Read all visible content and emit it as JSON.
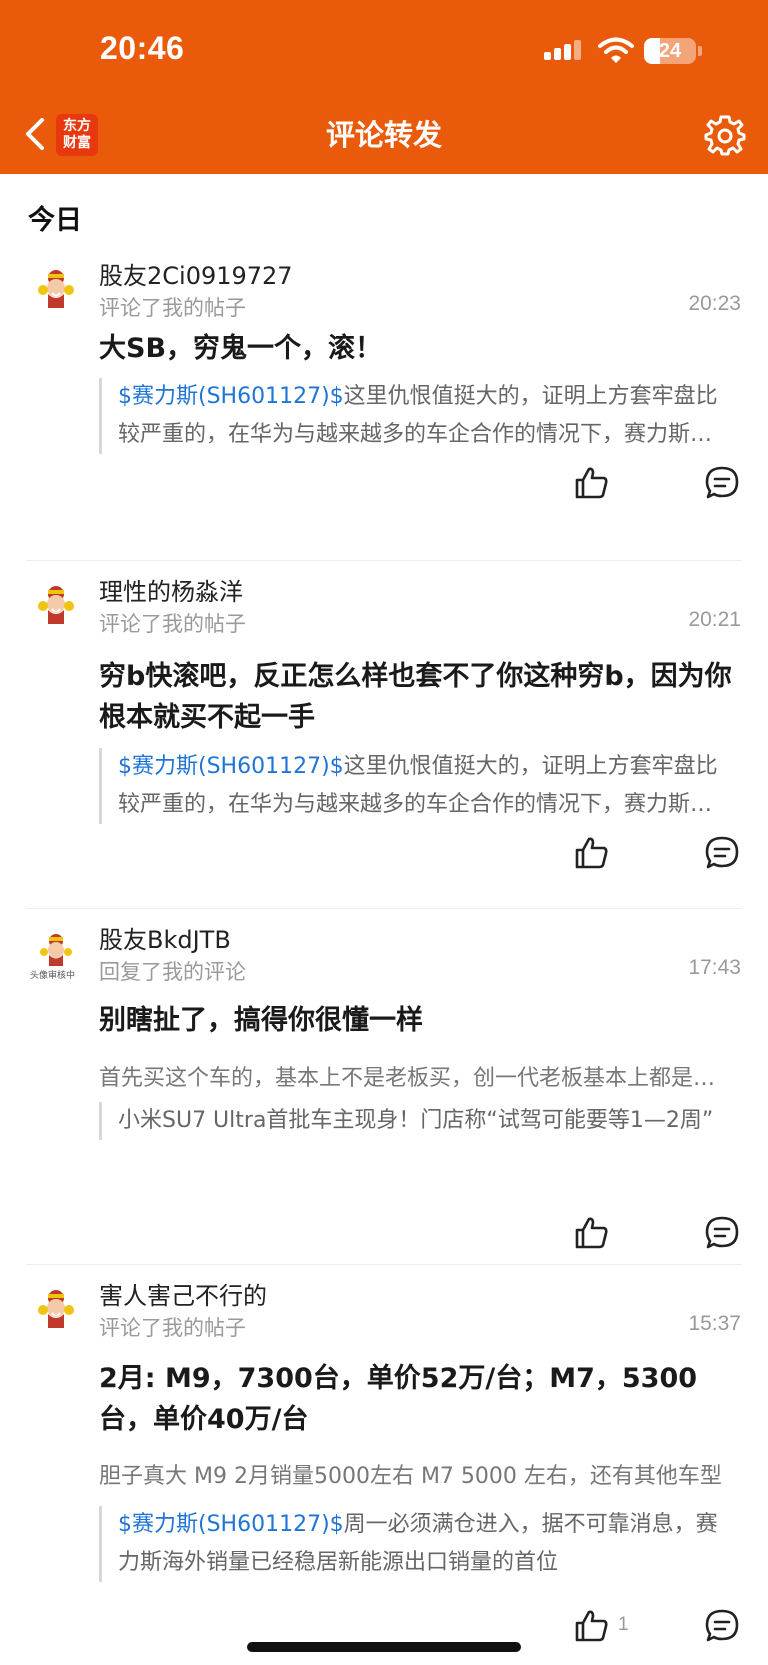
{
  "status_bar": {
    "time": "20:46",
    "battery": "24"
  },
  "header": {
    "logo_line1": "东方",
    "logo_line2": "财富",
    "title": "评论转发"
  },
  "section_title": "今日",
  "items": [
    {
      "username": "股友2Ci0919727",
      "action": "评论了我的帖子",
      "time": "20:23",
      "content": "大SB，穷鬼一个，滚！",
      "quote_stock": "$赛力斯(SH601127)$",
      "quote_text": "这里仇恨值挺大的，证明上方套牢盘比较严重的，在华为与越来越多的车企合作的情况下，赛力斯的优势已经不复存在",
      "like_count": ""
    },
    {
      "username": "理性的杨淼洋",
      "action": "评论了我的帖子",
      "time": "20:21",
      "content": "穷b快滚吧，反正怎么样也套不了你这种穷b，因为你根本就买不起一手",
      "quote_stock": "$赛力斯(SH601127)$",
      "quote_text": "这里仇恨值挺大的，证明上方套牢盘比较严重的，在华为与越来越多的车企合作的情况下，赛力斯的优势已经不复存在",
      "like_count": ""
    },
    {
      "username": "股友BkdJTB",
      "avatar_tag": "头像审核中",
      "action": "回复了我的评论",
      "time": "17:43",
      "content": "别瞎扯了，搞得你很懂一样",
      "reply_text": "首先买这个车的，基本上不是老板买，创一代老板基本上都是年纪比较大的",
      "quote_text": "小米SU7 Ultra首批车主现身！门店称“试驾可能要等1—2周”",
      "like_count": ""
    },
    {
      "username": "害人害己不行的",
      "action": "评论了我的帖子",
      "time": "15:37",
      "content": "2月: M9，7300台，单价52万/台；M7，5300台，单价40万/台",
      "reply_text": "胆子真大   M9     2月销量5000左右    M7 5000 左右，还有其他车型",
      "quote_stock": "$赛力斯(SH601127)$",
      "quote_text": "周一必须满仓进入，据不可靠消息，赛力斯海外销量已经稳居新能源出口销量的首位",
      "like_count": "1"
    }
  ]
}
